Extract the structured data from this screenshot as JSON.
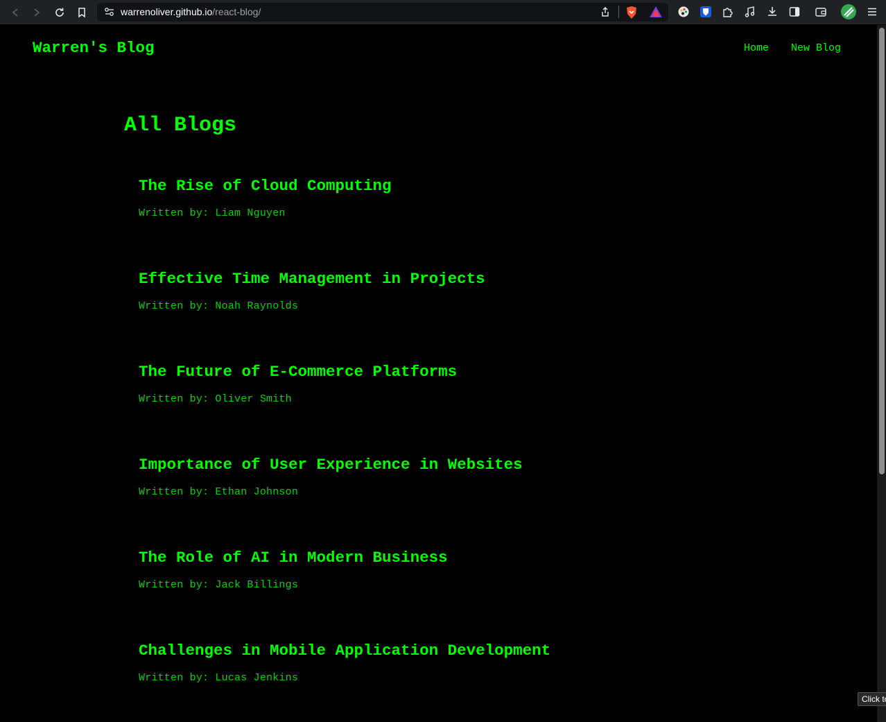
{
  "browser": {
    "url_host": "warrenoliver.github.io",
    "url_path": "/react-blog/"
  },
  "site": {
    "title": "Warren's Blog",
    "nav": [
      {
        "label": "Home"
      },
      {
        "label": "New Blog"
      }
    ]
  },
  "main": {
    "heading": "All Blogs",
    "blogs": [
      {
        "title": "The Rise of Cloud Computing",
        "author": "Written by: Liam Nguyen"
      },
      {
        "title": "Effective Time Management in Projects",
        "author": "Written by: Noah Raynolds"
      },
      {
        "title": "The Future of E-Commerce Platforms",
        "author": "Written by: Oliver Smith"
      },
      {
        "title": "Importance of User Experience in Websites",
        "author": "Written by: Ethan Johnson"
      },
      {
        "title": "The Role of AI in Modern Business",
        "author": "Written by: Jack Billings"
      },
      {
        "title": "Challenges in Mobile Application Development",
        "author": "Written by: Lucas Jenkins"
      }
    ]
  },
  "tooltip": {
    "text": "Click to"
  },
  "colors": {
    "accent": "#00ff00",
    "background": "#000000",
    "chrome": "#202124"
  },
  "icons": {
    "browser": [
      "back-icon",
      "forward-icon",
      "reload-icon",
      "bookmark-icon",
      "site-settings-icon",
      "share-icon"
    ],
    "extensions": [
      "brave-shield-icon",
      "brave-rewards-icon",
      "palette-extension-icon",
      "bitwarden-icon",
      "extensions-puzzle-icon",
      "media-music-icon",
      "download-icon",
      "sidebar-icon",
      "wallet-icon",
      "profile-avatar-icon",
      "menu-icon"
    ]
  }
}
